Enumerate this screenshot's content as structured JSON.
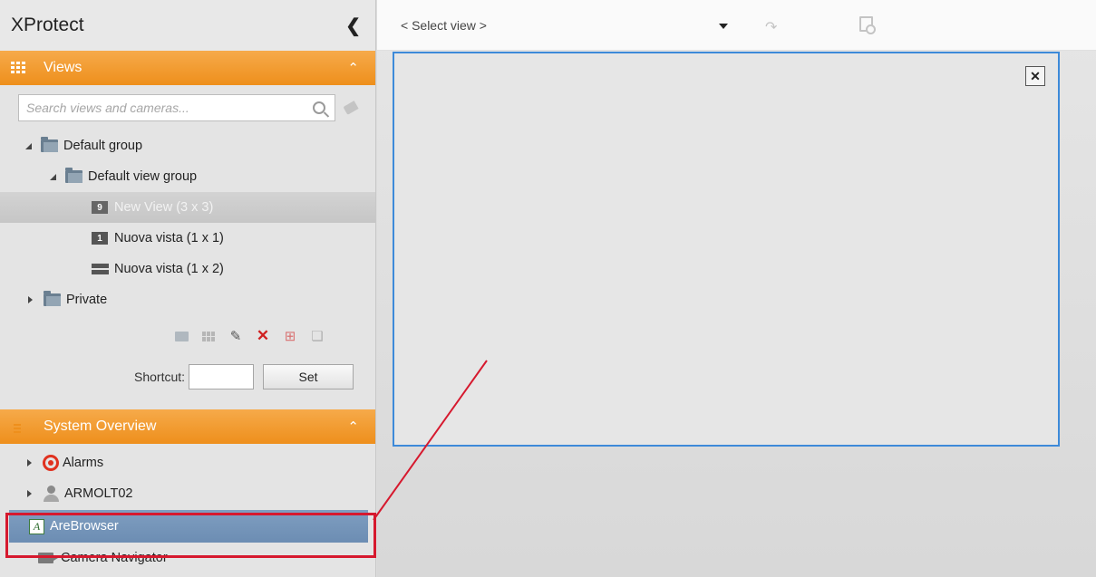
{
  "app": {
    "title": "XProtect"
  },
  "views_pane": {
    "title": "Views",
    "search_placeholder": "Search views and cameras...",
    "tree": {
      "default_group": "Default group",
      "default_view_group": "Default view group",
      "views": [
        {
          "badge": "9",
          "label": "New View (3 x 3)"
        },
        {
          "badge": "1",
          "label": "Nuova vista (1 x 1)"
        },
        {
          "badge": "",
          "label": "Nuova vista (1 x 2)"
        }
      ],
      "private": "Private"
    },
    "shortcut_label": "Shortcut:",
    "set_label": "Set"
  },
  "system_pane": {
    "title": "System Overview",
    "items": [
      "Alarms",
      "ARMOLT02",
      "AreBrowser",
      "Camera Navigator"
    ]
  },
  "top_bar": {
    "select_view": "< Select view >"
  },
  "accent_colors": {
    "orange": "#ee8f1c",
    "selection_blue": "#6c8db3",
    "frame_blue": "#3d8ad9",
    "highlight_red": "#d6192e"
  }
}
